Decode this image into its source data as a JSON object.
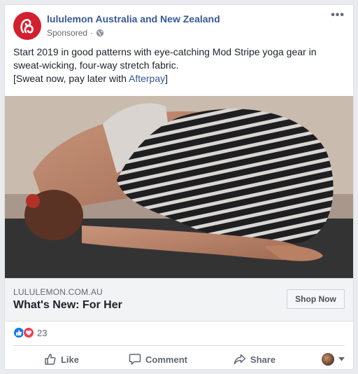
{
  "post": {
    "page_name": "lululemon Australia and New Zealand",
    "sponsored": "Sponsored",
    "separator": "·",
    "body_line1": "Start 2019 in good patterns with eye-catching Mod Stripe yoga gear in sweat-wicking, four-way stretch fabric.",
    "body_line2_prefix": "[Sweat now, pay later with ",
    "body_line2_link": "Afterpay",
    "body_line2_suffix": "]"
  },
  "link_preview": {
    "domain": "LULULEMON.COM.AU",
    "headline": "What's New: For Her",
    "cta_label": "Shop Now"
  },
  "reactions": {
    "count": "23",
    "icons": [
      "like-reaction-icon",
      "love-reaction-icon"
    ]
  },
  "actions": {
    "like": "Like",
    "comment": "Comment",
    "share": "Share"
  },
  "colors": {
    "brand_red": "#d31f2e",
    "link_blue": "#385898",
    "like_blue": "#1877f2",
    "love_red": "#f33e58"
  }
}
